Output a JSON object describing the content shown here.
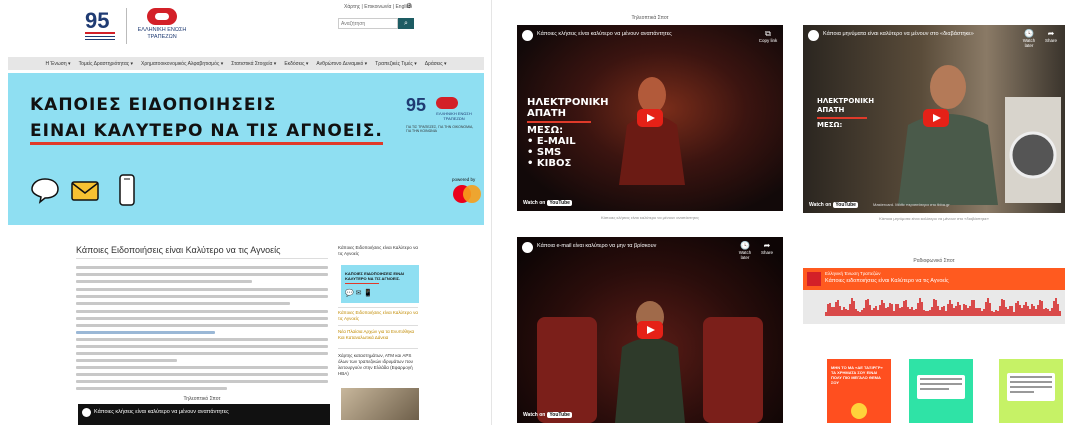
{
  "left_page": {
    "header": {
      "logo_number": "95",
      "bank_name": "ΕΛΛΗΝΙΚΗ ΕΝΩΣΗ ΤΡΑΠΕΖΩΝ",
      "top_links": "Χάρτης | Επικοινωνία | English",
      "search_placeholder": "Αναζήτηση"
    },
    "nav": [
      "Η Ένωση",
      "Τομείς Δραστηριότητας",
      "Χρηματοοικονομικός Αλφαβητισμός",
      "Στατιστικά Στοιχεία",
      "Εκδόσεις",
      "Ανθρώπινο Δυναμικό",
      "Τραπεζικές Τιμές",
      "Δράσεις"
    ],
    "banner": {
      "headline_line1": "ΚΑΠΟΙΕΣ ΕΙΔΟΠΟΙΗΣΕΙΣ",
      "headline_line2": "ΕΙΝΑΙ ΚΑΛΥΤΕΡΟ ΝΑ ΤΙΣ ΑΓΝΟΕΙΣ.",
      "logo_number": "95",
      "logo_name": "ΕΛΛΗΝΙΚΗ ΕΝΩΣΗ ΤΡΑΠΕΖΩΝ",
      "logo_sub": "ΓΙΑ ΤΙΣ ΤΡΑΠΕΖΕΣ, ΓΙΑ ΤΗΝ ΟΙΚΟΝΟΜΙΑ, ΓΙΑ ΤΗΝ ΚΟΙΝΩΝΙΑ",
      "powered_by": "powered by",
      "icons": [
        "speech-bubble-icon",
        "envelope-icon",
        "mobile-phone-icon"
      ],
      "accent": "#8fdff2"
    },
    "article": {
      "title": "Κάποιες Ειδοποιήσεις είναι Καλύτερο να τις Αγνοείς",
      "tv_spot_label": "Τηλεοπτικό Σποτ",
      "video_title": "Κάποιες κλήσεις είναι καλύτερο να μένουν αναπάντητες"
    },
    "sidebar": {
      "title": "Κάποιες Ειδοποιήσεις είναι Καλύτερο να τις Αγνοείς",
      "thumb_text": "ΚΑΠΟΙΕΣ ΕΙΔΟΠΟΙΗΣΕΙΣ ΕΙΝΑΙ ΚΑΛΥΤΕΡΟ ΝΑ ΤΙΣ ΑΓΝΟΕΙΣ.",
      "link1": "Κάποιες Ειδοποιήσεις είναι Καλύτερο να τις Αγνοείς",
      "link2": "Νέα Πλαίσια Αρχών για τα Ενυπόθηκα Και Καταναλωτικά Δάνεια",
      "news_text": "Χάρτης καταστημάτων, ΑΤΜ και APS όλων των τραπεζικών ιδρυμάτων που λειτουργούν στην Ελλάδα (Εφαρμογή ΗΒΑ)"
    }
  },
  "right_panel": {
    "tv_spots_label": "Τηλεοπτικά Σποτ",
    "videos": [
      {
        "title": "Κάποιες κλήσεις είναι καλύτερο να μένουν αναπάντητες",
        "ctl_label": "Copy link",
        "overlay_lines": [
          "ΗΛΕΚΤΡΟΝΙΚΗ",
          "ΑΠΑΤΗ",
          "ΜΕΣΩ:"
        ],
        "bullets": [
          "• E-MAIL",
          "• SMS",
          "• ΚΙΒΟΣ"
        ],
        "watch_on": "Watch on",
        "youtube": "YouTube",
        "caption": "Κάποιες κλήσεις είναι καλύτερο να μένουν αναπάντητες"
      },
      {
        "title": "Κάποια μηνύματα είναι καλύτερο να μένουν στο «διαβάστηκε»",
        "ctl_label": "Watch later",
        "ctl_label2": "Share",
        "overlay_lines": [
          "ΗΛΕΚΤΡΟΝΙΚΗ",
          "ΑΠΑΤΗ",
          "ΜΕΣΩ:"
        ],
        "watch_on": "Watch on",
        "youtube": "YouTube",
        "bottom_text": "Mastercard. Μάθε περισσότερα στο tbba.gr",
        "caption": "Κάποια μηνύματα είναι καλύτερο να μένουν στο «διαβάστηκε»"
      },
      {
        "title": "Κάποια e-mail είναι καλύτερο να μην τα βρίσκουν",
        "ctl_label": "Watch later",
        "ctl_label2": "Share",
        "watch_on": "Watch on",
        "youtube": "YouTube"
      }
    ],
    "radio_label": "Ραδιοφωνικό Σποτ",
    "radio": {
      "artist": "Ελληνική Ένωση Τραπεζών",
      "track": "Κάποιες ειδοποιήσεις είναι Καλύτερο να τις Αγνοείς"
    },
    "cards": [
      {
        "text": "ΜΗΝ ΤΟ ΜΑ «ΔΕ ΤΑΞΙΡΓΡ» ΤΑ ΧΡΗΜΑΤΑ ΣΟΥ ΕΙΝΑΙ ΠΟΛΥ ΠΙΟ ΜΕΓΑΛΟ ΘΕΜΑ ΣΟΥ",
        "color": "#ff4f1f"
      },
      {
        "text": "",
        "color": "#2fe3a6"
      },
      {
        "text": "",
        "color": "#c6f266"
      }
    ]
  }
}
